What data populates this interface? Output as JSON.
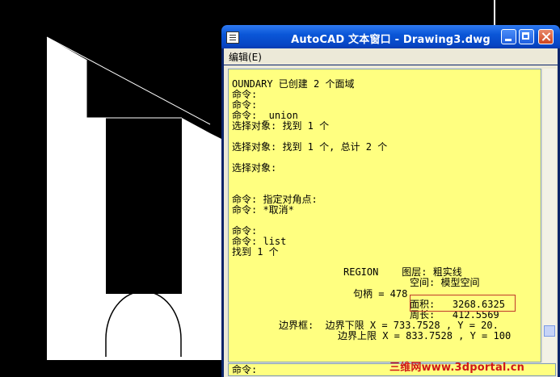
{
  "window": {
    "title": "AutoCAD 文本窗口 - Drawing3.dwg",
    "menu": "编辑(E)"
  },
  "text_lines": [
    {
      "id": "l1",
      "text": "OUNDARY 已创建 2 个面域"
    },
    {
      "id": "l2",
      "text": "命令:"
    },
    {
      "id": "l3",
      "text": "命令:"
    },
    {
      "id": "l4",
      "text": "命令: _union"
    },
    {
      "id": "l5",
      "text": "选择对象: 找到 1 个"
    },
    {
      "id": "l6",
      "text": "选择对象: 找到 1 个, 总计 2 个"
    },
    {
      "id": "l7",
      "text": "选择对象:"
    },
    {
      "id": "l8",
      "text": "命令: 指定对角点:"
    },
    {
      "id": "l9",
      "text": "命令: *取消*"
    },
    {
      "id": "l10",
      "text": "命令:"
    },
    {
      "id": "l11",
      "text": "命令: list"
    },
    {
      "id": "l12",
      "text": "找到 1 个"
    },
    {
      "id": "l13",
      "text": "REGION    图层: 粗实线"
    },
    {
      "id": "l14",
      "text": "空间: 模型空间"
    },
    {
      "id": "l15",
      "text": "句柄 = 478"
    },
    {
      "id": "l16",
      "text": "面积:   3268.6325"
    },
    {
      "id": "l17",
      "text": "周长:   412.5569"
    },
    {
      "id": "l18",
      "text": "边界框:  边界下限 X = 733.7528 , Y = 20."
    },
    {
      "id": "l19",
      "text": "边界上限 X = 833.7528 , Y = 100"
    }
  ],
  "command_line": "命令:",
  "watermark": "三维网www.3dportal.cn"
}
